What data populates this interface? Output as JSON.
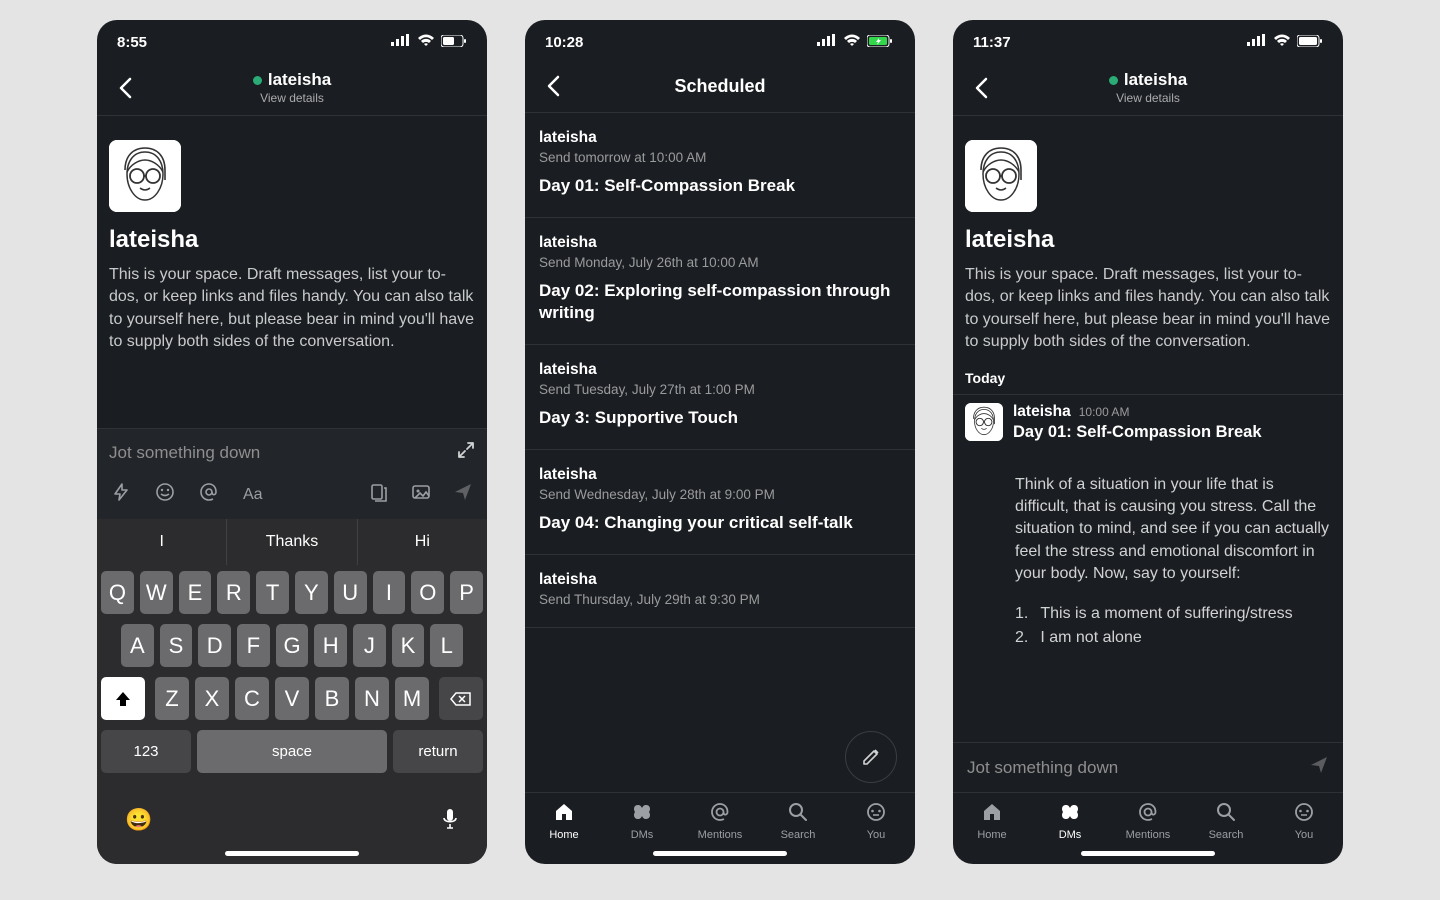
{
  "screen1": {
    "status": {
      "time": "8:55"
    },
    "header": {
      "title": "lateisha",
      "subtitle": "View details"
    },
    "profile": {
      "name": "lateisha",
      "description": "This is your space. Draft messages, list your to-dos, or keep links and files handy. You can also talk to yourself here, but please bear in mind you'll have to supply both sides of the conversation."
    },
    "compose": {
      "placeholder": "Jot something down"
    },
    "keyboard": {
      "suggestions": [
        "I",
        "Thanks",
        "Hi"
      ],
      "row1": [
        "Q",
        "W",
        "E",
        "R",
        "T",
        "Y",
        "U",
        "I",
        "O",
        "P"
      ],
      "row2": [
        "A",
        "S",
        "D",
        "F",
        "G",
        "H",
        "J",
        "K",
        "L"
      ],
      "row3": [
        "Z",
        "X",
        "C",
        "V",
        "B",
        "N",
        "M"
      ],
      "key123": "123",
      "space": "space",
      "return": "return"
    }
  },
  "screen2": {
    "status": {
      "time": "10:28"
    },
    "header": {
      "title": "Scheduled"
    },
    "items": [
      {
        "sender": "lateisha",
        "schedule": "Send tomorrow at 10:00 AM",
        "title": "Day 01: Self-Compassion Break"
      },
      {
        "sender": "lateisha",
        "schedule": "Send Monday, July 26th at 10:00 AM",
        "title": "Day 02: Exploring self-compassion through writing"
      },
      {
        "sender": "lateisha",
        "schedule": "Send Tuesday, July 27th at 1:00 PM",
        "title": "Day 3: Supportive Touch"
      },
      {
        "sender": "lateisha",
        "schedule": "Send Wednesday, July 28th at 9:00 PM",
        "title": "Day 04: Changing your critical self-talk"
      },
      {
        "sender": "lateisha",
        "schedule": "Send Thursday, July 29th at 9:30 PM",
        "title": ""
      }
    ],
    "tabs": [
      "Home",
      "DMs",
      "Mentions",
      "Search",
      "You"
    ],
    "active_tab": 0
  },
  "screen3": {
    "status": {
      "time": "11:37"
    },
    "header": {
      "title": "lateisha",
      "subtitle": "View details"
    },
    "profile": {
      "name": "lateisha",
      "description": "This is your space. Draft messages, list your to-dos, or keep links and files handy. You can also talk to yourself here, but please bear in mind you'll have to supply both sides of the conversation."
    },
    "divider": "Today",
    "message": {
      "sender": "lateisha",
      "time": "10:00 AM",
      "title": "Day 01: Self-Compassion Break",
      "body": "Think of a situation in your life that is difficult, that is causing you stress. Call the situation to mind, and see if you can actually feel the stress and emotional discomfort in your body. Now, say to yourself:",
      "list": [
        "This is a moment of suffering/stress",
        "I am not alone"
      ]
    },
    "compose": {
      "placeholder": "Jot something down"
    },
    "tabs": [
      "Home",
      "DMs",
      "Mentions",
      "Search",
      "You"
    ],
    "active_tab": 1
  }
}
